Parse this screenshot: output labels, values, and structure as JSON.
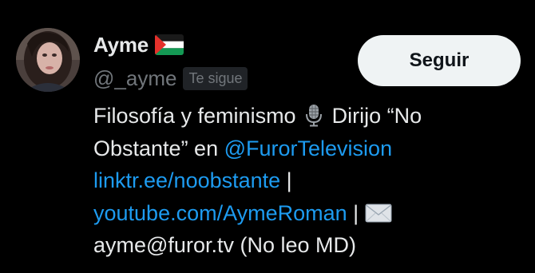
{
  "profile": {
    "display_name": "Ayme",
    "handle": "@_ayme",
    "follows_you_badge": "Te sigue",
    "flag_icon": "palestine-flag-icon",
    "follow_button_label": "Seguir"
  },
  "bio": {
    "line1_text": "Filosofía y feminismo ",
    "line1_text_after_icon": " Dirijo “No",
    "line2_text": "Obstante” en ",
    "line2_mention": "@FurorTelevision",
    "line3_link": "linktr.ee/noobstante",
    "line3_sep": " |",
    "line4_link": "youtube.com/AymeRoman",
    "line4_sep": " | ",
    "line5_text": "ayme@furor.tv (No leo MD)",
    "microphone_icon": "microphone-icon",
    "envelope_icon": "envelope-icon"
  },
  "colors": {
    "background": "#000000",
    "primary_text": "#e7e9ea",
    "secondary_text": "#71767b",
    "link": "#1d9bf0",
    "badge_bg": "#202327",
    "button_bg": "#eff3f4",
    "button_text": "#0f1419"
  }
}
